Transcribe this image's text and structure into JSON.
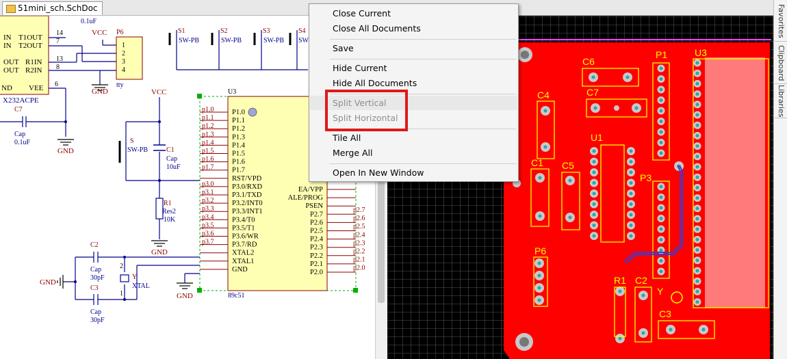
{
  "tab": {
    "title": "51mini_sch.SchDoc"
  },
  "context_menu": {
    "items": [
      {
        "label": "Close Current",
        "enabled": true
      },
      {
        "label": "Close All Documents",
        "enabled": true
      },
      {
        "label": "Save",
        "enabled": true
      },
      {
        "label": "Hide Current",
        "enabled": true
      },
      {
        "label": "Hide All Documents",
        "enabled": true
      },
      {
        "label": "Split Vertical",
        "enabled": false
      },
      {
        "label": "Split Horizontal",
        "enabled": false
      },
      {
        "label": "Tile All",
        "enabled": true
      },
      {
        "label": "Merge All",
        "enabled": true
      },
      {
        "label": "Open In New Window",
        "enabled": true
      }
    ]
  },
  "right_panel": {
    "tabs": [
      "Favorites",
      "Clipboard",
      "Libraries"
    ]
  },
  "colors": {
    "pcb_copper": "#ff0000",
    "silkscreen": "#ffff00",
    "highlight_box": "#e0181a",
    "schematic_wire": "#00008b",
    "schematic_label": "#8b0000"
  },
  "schematic": {
    "left_chip": {
      "pins_left": [
        "IN",
        "IN",
        "OUT",
        "OUT",
        "ND"
      ],
      "pins_right": [
        "T1OUT",
        "T2OUT",
        "R1IN",
        "R2IN",
        "VEE"
      ],
      "pin_numbers": [
        "14",
        "7",
        "13",
        "8",
        "6"
      ],
      "part": "X232ACPE"
    },
    "cap_top": "0.1uF",
    "c7": {
      "designator": "C7",
      "type": "Cap",
      "value": "0.1uF"
    },
    "p6": {
      "designator": "P6",
      "pins": [
        "1",
        "2",
        "3",
        "4"
      ],
      "name": "tty"
    },
    "vcc_labels": [
      "VCC",
      "VCC"
    ],
    "gnd_labels": [
      "GND",
      "GND",
      "GND",
      "GND",
      "GND"
    ],
    "switches": [
      {
        "designator": "S1",
        "type": "SW-PB"
      },
      {
        "designator": "S2",
        "type": "SW-PB"
      },
      {
        "designator": "S3",
        "type": "SW-PB"
      },
      {
        "designator": "S4",
        "type": "SW-PB"
      }
    ],
    "sw_main": {
      "designator": "S",
      "type": "SW-PB"
    },
    "c1": {
      "designator": "C1",
      "type": "Cap",
      "value": "10uF"
    },
    "r1": {
      "designator": "R1",
      "type": "Res2",
      "value": "10K"
    },
    "c2": {
      "designator": "C2",
      "type": "Cap",
      "value": "30pF"
    },
    "c3": {
      "designator": "C3",
      "type": "Cap",
      "value": "30pF"
    },
    "crystal": {
      "designator": "Y",
      "type": "XTAL",
      "pin1": "1",
      "pin2": "2"
    },
    "u3": {
      "designator": "U3",
      "part": "89c51",
      "left_nets": [
        "p1.0",
        "p1.1",
        "p1.2",
        "p1.3",
        "p1.4",
        "p1.5",
        "p1.6",
        "p1.7",
        "p3.0",
        "p3.1",
        "p3.2",
        "p3.3",
        "p3.4",
        "p3.5",
        "p3.6",
        "p3.7"
      ],
      "left_pins": [
        "P1.0",
        "P1.1",
        "P1.2",
        "P1.3",
        "P1.4",
        "P1.5",
        "P1.6",
        "P1.7",
        "RST/VPD",
        "P3.0/RXD",
        "P3.1/TXD",
        "P3.2/INT0",
        "P3.3/INT1",
        "P3.4/T0",
        "P3.5/T1",
        "P3.6/WR",
        "P3.7/RD",
        "XTAL2",
        "XTAL1",
        "GND"
      ],
      "right_pins": [
        "EA/VPP",
        "ALE/PROG",
        "PSEN",
        "P2.7",
        "P2.6",
        "P2.5",
        "P2.4",
        "P2.3",
        "P2.2",
        "P2.1",
        "P2.0"
      ],
      "right_nets": [
        "p2.7",
        "p2.6",
        "p2.5",
        "p2.4",
        "p2.3",
        "p2.2",
        "p2.1",
        "p2.0"
      ]
    }
  },
  "pcb": {
    "labels": [
      "C6",
      "P1",
      "U3",
      "C4",
      "C7",
      "U1",
      "C1",
      "C5",
      "P3",
      "P6",
      "R1",
      "C2",
      "Y",
      "C3"
    ]
  }
}
